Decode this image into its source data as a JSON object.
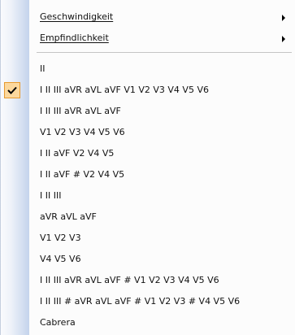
{
  "menu": {
    "submenus": [
      {
        "label": "Geschwindigkeit",
        "mnemonic": "G"
      },
      {
        "label": "Empfindlichkeit",
        "mnemonic": "E"
      }
    ],
    "leads": [
      {
        "label": "II",
        "checked": false
      },
      {
        "label": "I II III aVR aVL aVF V1 V2 V3 V4 V5 V6",
        "checked": true
      },
      {
        "label": "I II III aVR aVL aVF",
        "checked": false
      },
      {
        "label": "V1 V2 V3 V4 V5 V6",
        "checked": false
      },
      {
        "label": "I II aVF V2 V4 V5",
        "checked": false
      },
      {
        "label": "I II aVF # V2 V4 V5",
        "checked": false
      },
      {
        "label": "I II III",
        "checked": false
      },
      {
        "label": "aVR aVL aVF",
        "checked": false
      },
      {
        "label": "V1 V2 V3",
        "checked": false
      },
      {
        "label": "V4 V5 V6",
        "checked": false
      },
      {
        "label": "I II III aVR aVL aVF # V1 V2 V3 V4 V5 V6",
        "checked": false
      },
      {
        "label": "I II III # aVR aVL aVF # V1 V2 V3 # V4 V5 V6",
        "checked": false
      },
      {
        "label": "Cabrera",
        "checked": false
      }
    ]
  },
  "icons": {
    "submenu_arrow": "submenu-arrow-icon",
    "checkmark": "checkmark-icon"
  },
  "colors": {
    "check_background": "#fcd89d",
    "check_border": "#e79a2e",
    "icon_column": "#c4d3ec"
  }
}
